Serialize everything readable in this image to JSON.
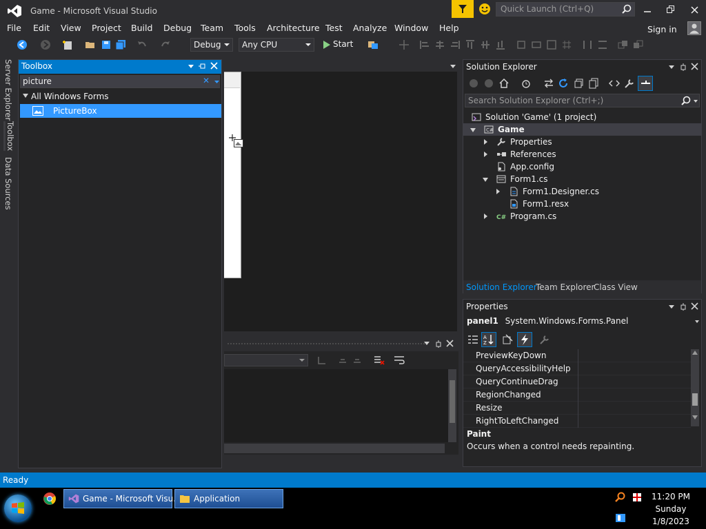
{
  "window": {
    "title": "Game - Microsoft Visual Studio",
    "quick_launch_placeholder": "Quick Launch (Ctrl+Q)",
    "sign_in": "Sign in"
  },
  "menu": {
    "items": [
      "File",
      "Edit",
      "View",
      "Project",
      "Build",
      "Debug",
      "Team",
      "Tools",
      "Architecture",
      "Test",
      "Analyze",
      "Window",
      "Help"
    ]
  },
  "toolbar": {
    "config": "Debug",
    "platform": "Any CPU",
    "start_label": "Start"
  },
  "left_tabs": [
    "Server Explorer",
    "Toolbox",
    "Data Sources"
  ],
  "toolbox": {
    "title": "Toolbox",
    "search_value": "picture",
    "group_label": "All Windows Forms",
    "items": [
      "PictureBox"
    ]
  },
  "solution_explorer": {
    "title": "Solution Explorer",
    "search_placeholder": "Search Solution Explorer (Ctrl+;)",
    "tree": [
      {
        "label": "Solution 'Game' (1 project)",
        "level": 0,
        "icon": "solution-icon",
        "expander": "none"
      },
      {
        "label": "Game",
        "level": 1,
        "icon": "csharp-project-icon",
        "expander": "open",
        "bold": true
      },
      {
        "label": "Properties",
        "level": 2,
        "icon": "wrench-icon",
        "expander": "closed"
      },
      {
        "label": "References",
        "level": 2,
        "icon": "references-icon",
        "expander": "closed"
      },
      {
        "label": "App.config",
        "level": 2,
        "icon": "config-file-icon",
        "expander": "none"
      },
      {
        "label": "Form1.cs",
        "level": 2,
        "icon": "form-icon",
        "expander": "open"
      },
      {
        "label": "Form1.Designer.cs",
        "level": 3,
        "icon": "cs-file-icon",
        "expander": "closed"
      },
      {
        "label": "Form1.resx",
        "level": 3,
        "icon": "resx-file-icon",
        "expander": "none"
      },
      {
        "label": "Program.cs",
        "level": 2,
        "icon": "csharp-file-icon",
        "expander": "closed"
      }
    ],
    "tabs": [
      {
        "label": "Solution Explorer",
        "active": true
      },
      {
        "label": "Team Explorer",
        "active": false
      },
      {
        "label": "Class View",
        "active": false
      }
    ]
  },
  "properties": {
    "title": "Properties",
    "object_name": "panel1",
    "object_type": "System.Windows.Forms.Panel",
    "rows": [
      "PreviewKeyDown",
      "QueryAccessibilityHelp",
      "QueryContinueDrag",
      "RegionChanged",
      "Resize",
      "RightToLeftChanged"
    ],
    "desc_title": "Paint",
    "desc_text": "Occurs when a control needs repainting."
  },
  "status": {
    "text": "Ready"
  },
  "taskbar": {
    "buttons": [
      {
        "label": "Game - Microsoft Visu...",
        "icon": "visual-studio-icon"
      },
      {
        "label": "Application",
        "icon": "folder-icon"
      }
    ],
    "time": "11:20 PM",
    "day": "Sunday",
    "date": "1/8/2023"
  },
  "colors": {
    "accent": "#007acc",
    "selection": "#3399ff",
    "background": "#2d2d30",
    "panel": "#252526"
  }
}
